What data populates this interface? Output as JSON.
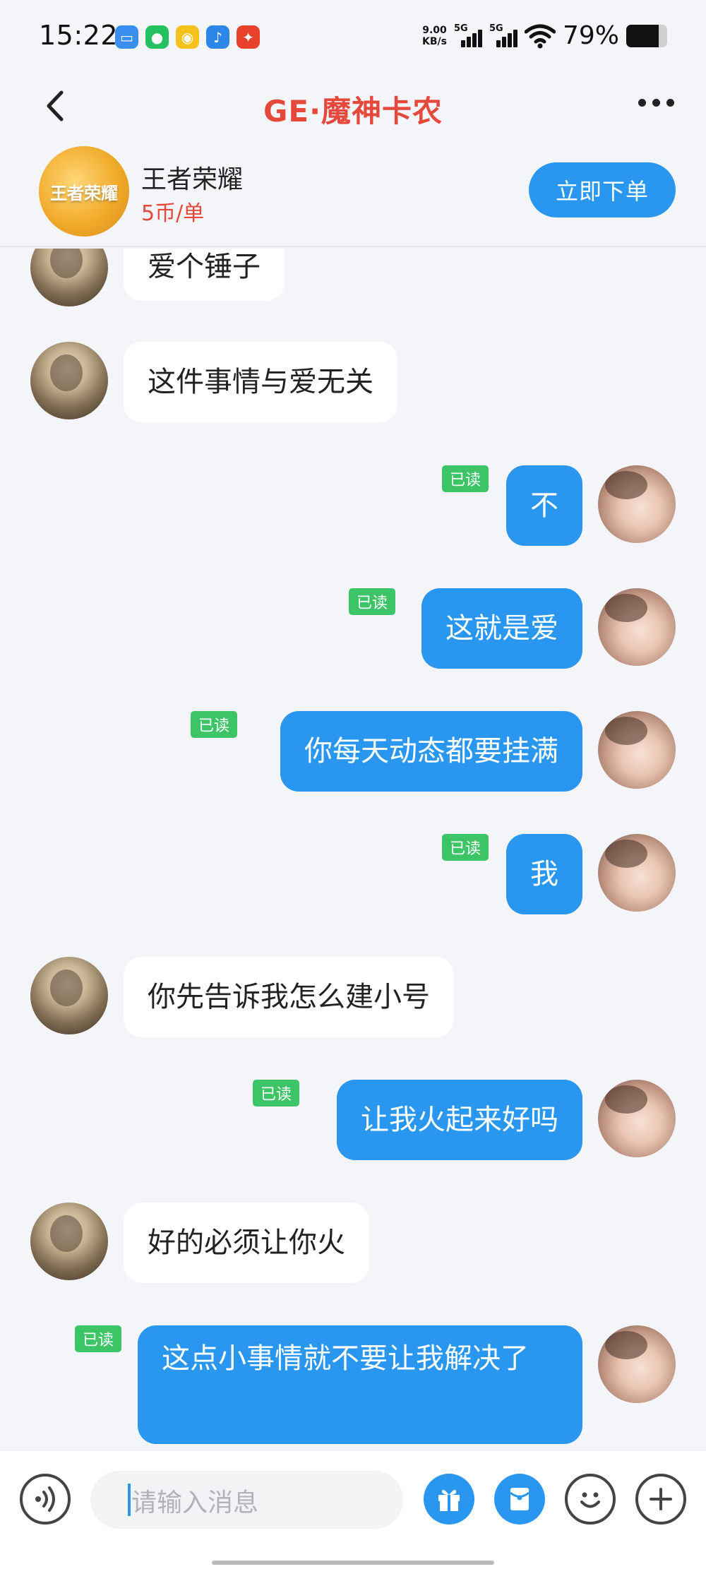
{
  "status_bar": {
    "time": "15:22",
    "net_speed_value": "9.00",
    "net_speed_unit": "KB/s",
    "signal_1_label": "5G",
    "signal_2_label": "5G",
    "battery_text": "79%",
    "battery_level": 0.79,
    "app_icons": [
      "screen-cast-icon",
      "wechat-icon",
      "app-icon",
      "game-icon",
      "weibo-icon"
    ]
  },
  "header": {
    "title": "GE·魔神卡农"
  },
  "game_card": {
    "logo_text": "王者荣耀",
    "name": "王者荣耀",
    "price": "5币/单",
    "order_button": "立即下单"
  },
  "messages": [
    {
      "side": "left",
      "text": "爱个锤子"
    },
    {
      "side": "left",
      "text": "这件事情与爱无关"
    },
    {
      "side": "right",
      "text": "不",
      "badge": "已读"
    },
    {
      "side": "right",
      "text": "这就是爱",
      "badge": "已读"
    },
    {
      "side": "right",
      "text": "你每天动态都要挂满",
      "badge": "已读"
    },
    {
      "side": "right",
      "text": "我",
      "badge": "已读"
    },
    {
      "side": "left",
      "text": "你先告诉我怎么建小号"
    },
    {
      "side": "right",
      "text": "让我火起来好吗",
      "badge": "已读"
    },
    {
      "side": "left",
      "text": "好的必须让你火"
    },
    {
      "side": "right",
      "text": "这点小事情就不要让我解决了",
      "badge": "已读"
    }
  ],
  "input": {
    "placeholder": "请输入消息"
  },
  "colors": {
    "accent": "#2997f0",
    "title_red": "#e5493c",
    "read_badge": "#3cc467",
    "background": "#f4f5f9"
  }
}
